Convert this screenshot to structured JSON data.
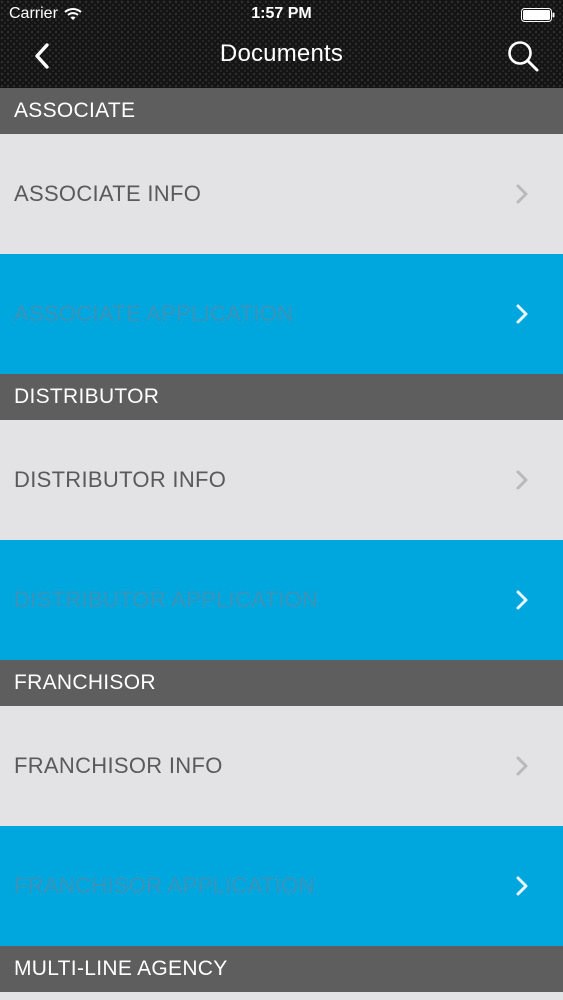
{
  "status_bar": {
    "carrier": "Carrier",
    "time": "1:57 PM",
    "wifi_icon": "wifi-icon",
    "battery_icon": "battery-icon"
  },
  "nav": {
    "title": "Documents",
    "back_icon": "chevron-left-icon",
    "search_icon": "search-icon"
  },
  "sections": [
    {
      "header": "ASSOCIATE",
      "rows": [
        {
          "label": "ASSOCIATE INFO",
          "style": "info"
        },
        {
          "label": "ASSOCIATE APPLICATION",
          "style": "app"
        }
      ]
    },
    {
      "header": "DISTRIBUTOR",
      "rows": [
        {
          "label": "DISTRIBUTOR INFO",
          "style": "info"
        },
        {
          "label": "DISTRIBUTOR APPLICATION",
          "style": "app"
        }
      ]
    },
    {
      "header": "FRANCHISOR",
      "rows": [
        {
          "label": "FRANCHISOR INFO",
          "style": "info"
        },
        {
          "label": "FRANCHISOR APPLICATION",
          "style": "app"
        }
      ]
    },
    {
      "header": "MULTI-LINE AGENCY",
      "rows": []
    }
  ],
  "colors": {
    "nav_background": "#141414",
    "section_header": "#5e5e5f",
    "info_row": "#e3e3e5",
    "application_row": "#00a7df"
  }
}
